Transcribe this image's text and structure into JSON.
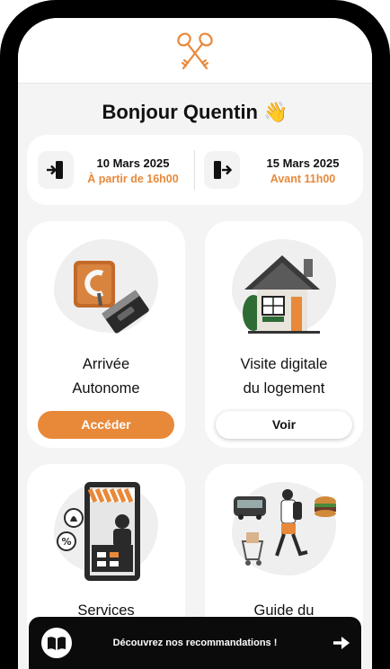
{
  "greeting": "Bonjour Quentin 👋",
  "checkin": {
    "date": "10 Mars 2025",
    "time": "À partir de 16h00",
    "icon": "door-enter-icon"
  },
  "checkout": {
    "date": "15 Mars 2025",
    "time": "Avant 11h00",
    "icon": "door-exit-icon"
  },
  "cards": [
    {
      "title_line1": "Arrivée",
      "title_line2": "Autonome",
      "button": "Accéder",
      "icon": "lockbox-icon"
    },
    {
      "title_line1": "Visite digitale",
      "title_line2": "du logement",
      "button": "Voir",
      "icon": "house-icon"
    },
    {
      "title_line1": "Services",
      "title_line2": "",
      "icon": "shop-icon"
    },
    {
      "title_line1": "Guide du",
      "title_line2": "",
      "icon": "travel-guide-icon"
    }
  ],
  "banner": {
    "text": "Découvrez nos recommandations !",
    "icon": "book-icon"
  },
  "colors": {
    "accent": "#e8893a",
    "background": "#f4f4f4",
    "banner": "#0b0b0b"
  }
}
